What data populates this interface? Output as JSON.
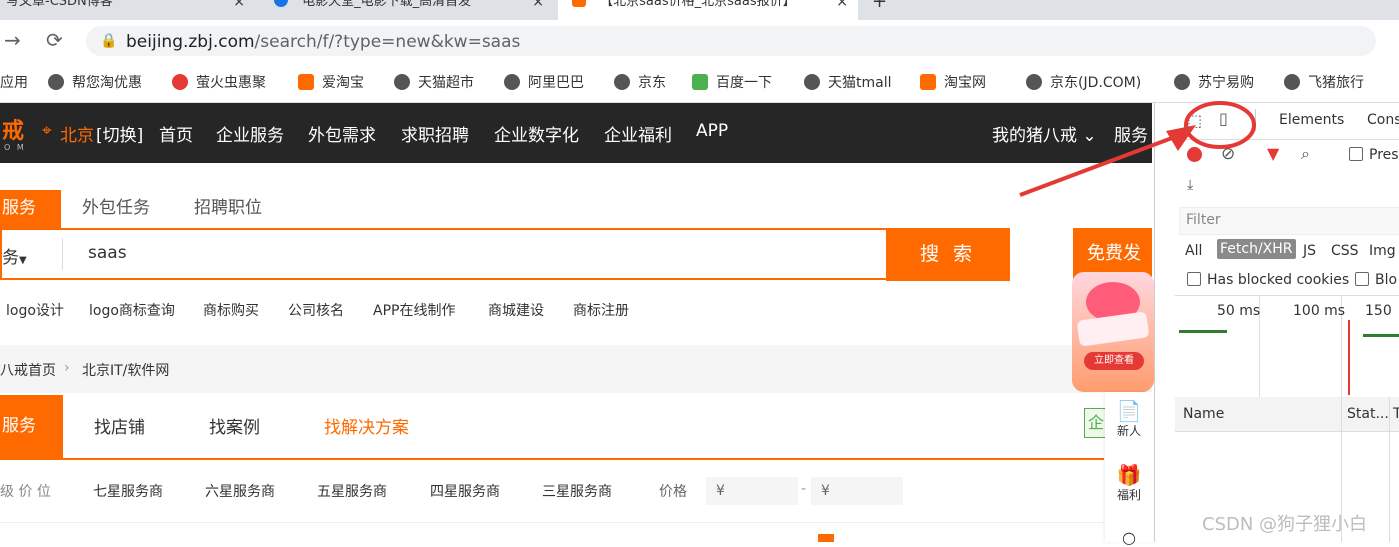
{
  "tabs": [
    "写文章-CSDN博客",
    "电影天堂_电影下载_高清首发",
    "【北京saas价格_北京saas报价】"
  ],
  "address": {
    "host": "beijing.zbj.com",
    "path": "/search/f/?type=new&kw=saas"
  },
  "bookmarks": [
    "应用",
    "帮您淘优惠",
    "萤火虫惠聚",
    "爱淘宝",
    "天猫超市",
    "阿里巴巴",
    "京东",
    "百度一下",
    "天猫tmall",
    "淘宝网",
    "京东(JD.COM)",
    "苏宁易购",
    "飞猪旅行"
  ],
  "site": {
    "logo_fragment": "戒",
    "logo_sub": "O M",
    "city": "北京",
    "city_switch": "[切换]",
    "nav": [
      "首页",
      "企业服务",
      "外包需求",
      "求职招聘",
      "企业数字化",
      "企业福利",
      "APP"
    ],
    "my_account": "我的猪八戒",
    "more": "服务",
    "search_tabs": [
      "服务",
      "外包任务",
      "招聘职位"
    ],
    "search_type": "务",
    "search_value": "saas",
    "search_button": "搜 索",
    "free_post": "免费发",
    "hot_keywords": [
      "logo设计",
      "logo商标查询",
      "商标购买",
      "公司核名",
      "APP在线制作",
      "商城建设",
      "商标注册"
    ],
    "breadcrumb": [
      "八戒首页",
      "北京IT/软件网"
    ],
    "nav_tabs": [
      "服务",
      "找店铺",
      "找案例",
      "找解决方案"
    ],
    "filter_label": "级 价 位",
    "filters": [
      "七星服务商",
      "六星服务商",
      "五星服务商",
      "四星服务商",
      "三星服务商"
    ],
    "price_label": "价格",
    "price_placeholder": "¥",
    "price_sep": "-",
    "promo_text": "立即查看",
    "rail": [
      {
        "label": "新人"
      },
      {
        "label": "福利"
      }
    ],
    "ad_badge": "企"
  },
  "devtools": {
    "tabs": [
      "Elements",
      "Cons"
    ],
    "preserve": "Pres",
    "filter_placeholder": "Filter",
    "types": [
      "All",
      "Fetch/XHR",
      "JS",
      "CSS",
      "Img"
    ],
    "blocked_cookies": "Has blocked cookies",
    "blocked_req": "Blo",
    "timeline": [
      "50 ms",
      "100 ms",
      "150"
    ],
    "columns": [
      "Name",
      "Stat...",
      "T"
    ]
  },
  "watermark": "CSDN @狗子狸小白",
  "colors": {
    "accent": "#ff6a00",
    "header": "#262626",
    "annotation": "#e53935"
  }
}
